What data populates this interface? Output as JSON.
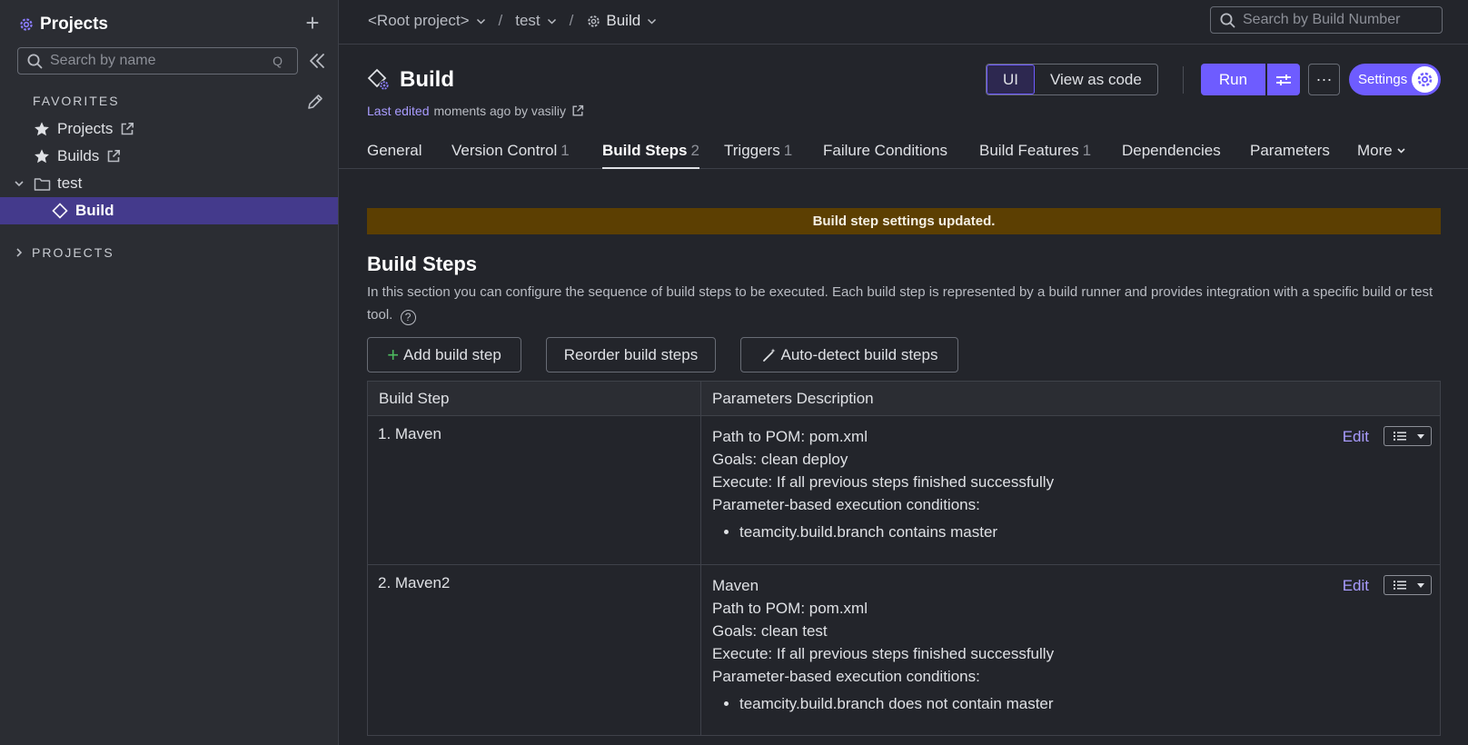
{
  "sidebar": {
    "title": "Projects",
    "search_placeholder": "Search by name",
    "search_hint": "Q",
    "favorites_label": "FAVORITES",
    "projects_label": "PROJECTS",
    "items": [
      {
        "label": "Projects",
        "icon": "star-icon"
      },
      {
        "label": "Builds",
        "icon": "star-icon"
      },
      {
        "label": "test",
        "icon": "folder-icon"
      },
      {
        "label": "Build",
        "icon": "build-config-icon"
      }
    ]
  },
  "topbar": {
    "crumbs": [
      "<Root project>",
      "test",
      "Build"
    ],
    "search_placeholder": "Search by Build Number"
  },
  "header": {
    "title": "Build",
    "last_edited_link": "Last edited",
    "last_edited_rest": "moments ago by vasiliy",
    "view_ui": "UI",
    "view_code": "View as code",
    "run": "Run",
    "more": "···",
    "settings": "Settings"
  },
  "tabs": [
    {
      "label": "General",
      "count": ""
    },
    {
      "label": "Version Control",
      "count": "1"
    },
    {
      "label": "Build Steps",
      "count": "2"
    },
    {
      "label": "Triggers",
      "count": "1"
    },
    {
      "label": "Failure Conditions",
      "count": ""
    },
    {
      "label": "Build Features",
      "count": "1"
    },
    {
      "label": "Dependencies",
      "count": ""
    },
    {
      "label": "Parameters",
      "count": ""
    },
    {
      "label": "More",
      "count": ""
    }
  ],
  "banner": "Build step settings updated.",
  "section": {
    "title": "Build Steps",
    "description": "In this section you can configure the sequence of build steps to be executed. Each build step is represented by a build runner and provides integration with a specific build or test tool.",
    "help": "?"
  },
  "actions": {
    "add": "Add build step",
    "reorder": "Reorder build steps",
    "autodetect": "Auto-detect build steps"
  },
  "table": {
    "headers": [
      "Build Step",
      "Parameters Description"
    ],
    "edit_label": "Edit",
    "rows": [
      {
        "name": "1. Maven",
        "lines": [
          "Path to POM: pom.xml",
          "Goals: clean deploy",
          "Execute: If all previous steps finished successfully",
          "Parameter-based execution conditions:"
        ],
        "conditions": [
          "teamcity.build.branch contains master"
        ]
      },
      {
        "name": "2. Maven2",
        "lines": [
          "Maven",
          "Path to POM: pom.xml",
          "Goals: clean test",
          "Execute: If all previous steps finished successfully",
          "Parameter-based execution conditions:"
        ],
        "conditions": [
          "teamcity.build.branch does not contain master"
        ]
      }
    ]
  },
  "colors": {
    "accent": "#6e5cff",
    "link": "#a99cff",
    "banner_bg": "#5c3f02",
    "selected_bg": "#443a8c",
    "add_plus": "#4dbb5f"
  }
}
